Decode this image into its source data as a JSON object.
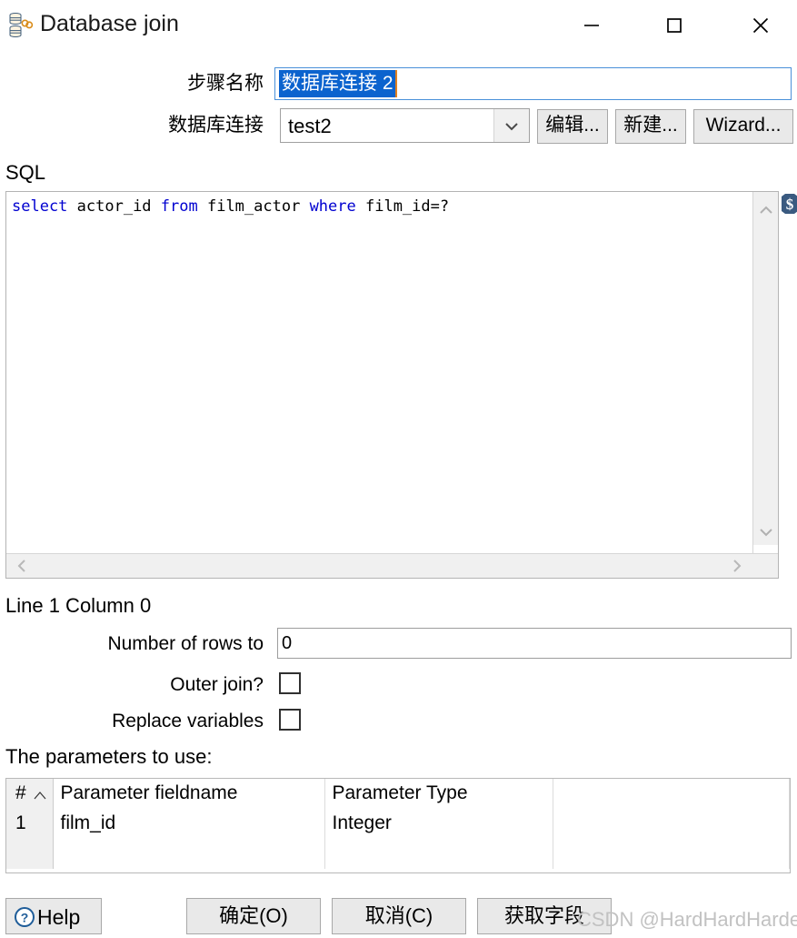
{
  "window": {
    "title": "Database join",
    "icon": "database-join-icon",
    "controls": {
      "minimize": "minimize-icon",
      "maximize": "maximize-icon",
      "close": "close-icon"
    }
  },
  "form": {
    "step_name_label": "步骤名称",
    "step_name_value": "数据库连接 2",
    "db_connection_label": "数据库连接",
    "db_connection_value": "test2",
    "db_connection_dropdown_icon": "chevron-down-icon",
    "edit_button": "编辑...",
    "new_button": "新建...",
    "wizard_button": "Wizard..."
  },
  "sql": {
    "section_label": "SQL",
    "tokens": [
      {
        "text": "select",
        "type": "keyword"
      },
      {
        "text": " actor_id ",
        "type": "plain"
      },
      {
        "text": "from",
        "type": "keyword"
      },
      {
        "text": " film_actor ",
        "type": "plain"
      },
      {
        "text": "where",
        "type": "keyword"
      },
      {
        "text": " film_id=?",
        "type": "plain"
      }
    ],
    "full_text": "select actor_id from film_actor where film_id=?",
    "status": "Line 1 Column 0",
    "variable_icon": "dollar-variable-icon",
    "scroll_up_icon": "chevron-up-icon",
    "scroll_down_icon": "chevron-down-icon",
    "scroll_left_icon": "chevron-left-icon",
    "scroll_right_icon": "chevron-right-icon"
  },
  "options": {
    "number_of_rows_label": "Number of rows to",
    "number_of_rows_value": "0",
    "outer_join_label": "Outer join?",
    "outer_join_checked": false,
    "replace_variables_label": "Replace variables",
    "replace_variables_checked": false
  },
  "parameters": {
    "caption": "The parameters to use:",
    "columns": [
      "#",
      "Parameter fieldname",
      "Parameter Type",
      ""
    ],
    "rows": [
      {
        "index": "1",
        "fieldname": "film_id",
        "type": "Integer",
        "extra": ""
      },
      {
        "index": "",
        "fieldname": "",
        "type": "",
        "extra": ""
      }
    ]
  },
  "footer": {
    "help_button": "Help",
    "help_icon": "question-circle-icon",
    "ok_button": "确定(O)",
    "cancel_button": "取消(C)",
    "get_fields_button": "获取字段"
  },
  "watermark": "CSDN @HardHardHardenna",
  "colors": {
    "selection_blue": "#0b63ce",
    "keyword_blue": "#0000d0",
    "caret_orange": "#e08020",
    "button_face": "#e9e9e9",
    "watermark_gray": "#c2c2c2"
  }
}
